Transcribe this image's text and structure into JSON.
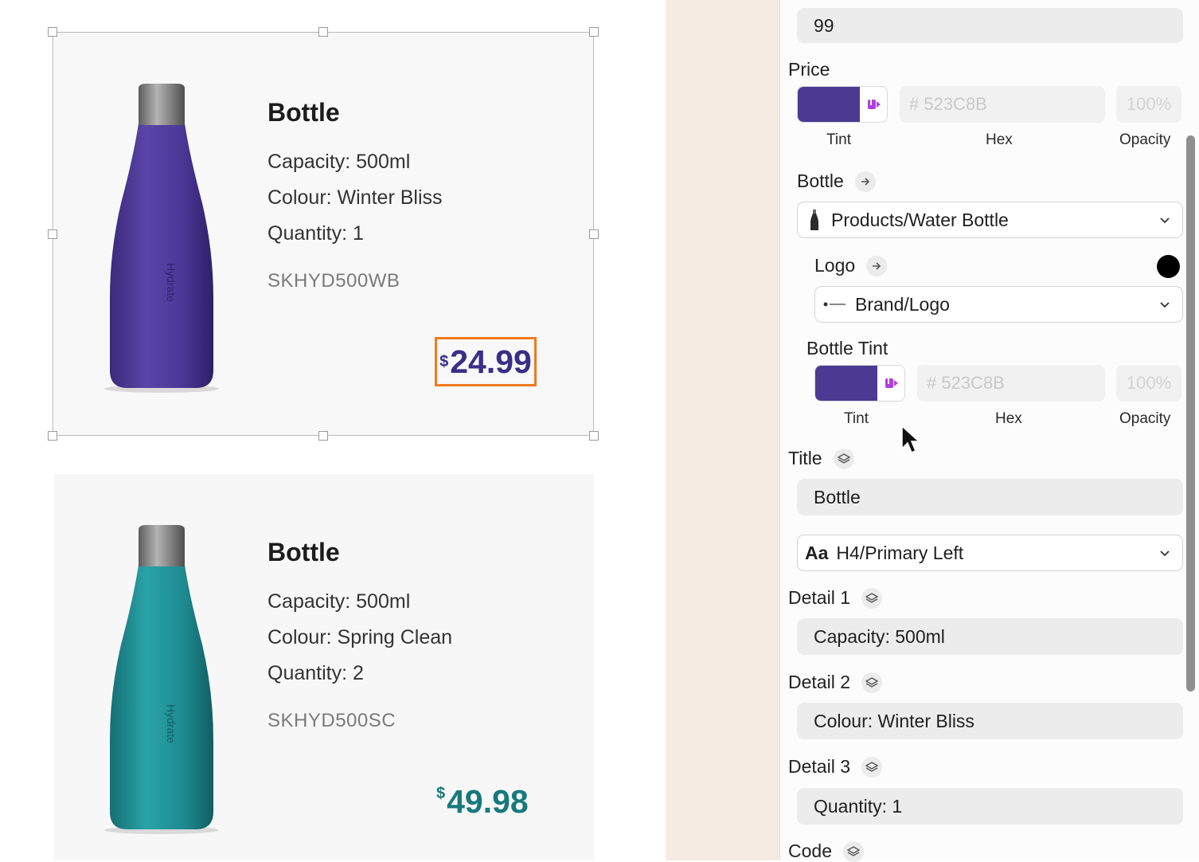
{
  "canvas": {
    "cards": [
      {
        "title": "Bottle",
        "details": [
          "Capacity: 500ml",
          "Colour: Winter Bliss",
          "Quantity: 1"
        ],
        "code": "SKHYD500WB",
        "price_symbol": "$",
        "price": "24.99",
        "bottle_color": "#523C8B",
        "bottle_text": "Hydrate",
        "selected": true
      },
      {
        "title": "Bottle",
        "details": [
          "Capacity: 500ml",
          "Colour: Spring Clean",
          "Quantity: 2"
        ],
        "code": "SKHYD500SC",
        "price_symbol": "$",
        "price": "49.98",
        "bottle_color": "#1E8C92",
        "bottle_text": "Hydrate",
        "selected": false
      }
    ]
  },
  "inspector": {
    "top_field_value": "99",
    "price_section": {
      "label": "Price",
      "hex_placeholder": "# 523C8B",
      "opacity_placeholder": "100%",
      "tint_label": "Tint",
      "hex_label": "Hex",
      "opacity_label": "Opacity",
      "swatch_color": "#4B3A92"
    },
    "bottle_section": {
      "label": "Bottle",
      "dropdown_value": "Products/Water Bottle"
    },
    "logo_section": {
      "label": "Logo",
      "dropdown_value": "Brand/Logo",
      "color_dot": "#000000"
    },
    "bottle_tint_section": {
      "label": "Bottle Tint",
      "hex_placeholder": "# 523C8B",
      "opacity_placeholder": "100%",
      "tint_label": "Tint",
      "hex_label": "Hex",
      "opacity_label": "Opacity",
      "swatch_color": "#4B3A92"
    },
    "title_section": {
      "label": "Title",
      "value": "Bottle",
      "style_prefix": "Aa",
      "style_value": "H4/Primary Left"
    },
    "detail1": {
      "label": "Detail 1",
      "value": "Capacity: 500ml"
    },
    "detail2": {
      "label": "Detail 2",
      "value": "Colour: Winter Bliss"
    },
    "detail3": {
      "label": "Detail 3",
      "value": "Quantity: 1"
    },
    "code_section": {
      "label": "Code"
    }
  },
  "colors": {
    "selection_outline": "#F07A1C",
    "price_purple": "#3A2E86",
    "price_teal": "#18797D",
    "strip_bg": "#F6EBE2"
  }
}
